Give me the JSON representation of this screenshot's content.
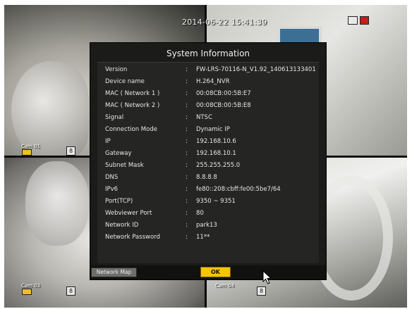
{
  "overlay": {
    "timestamp": "2014-06-22 15:41:39",
    "cameras": [
      {
        "label": "Cam 01",
        "channel": "8"
      },
      {
        "label": "Cam 03",
        "channel": "8"
      },
      {
        "label": "Cam 04",
        "channel": "8"
      }
    ]
  },
  "dialog": {
    "title": "System Information",
    "rows": [
      {
        "key": "Version",
        "value": "FW-LRS-70116-N_V1.92_140613133401"
      },
      {
        "key": "Device name",
        "value": "H.264_NVR"
      },
      {
        "key": "MAC ( Network 1 )",
        "value": "00:08CB:00:5B:E7"
      },
      {
        "key": "MAC ( Network 2 )",
        "value": "00:08CB:00:5B:E8"
      },
      {
        "key": "Signal",
        "value": "NTSC"
      },
      {
        "key": "Connection Mode",
        "value": "Dynamic IP"
      },
      {
        "key": "IP",
        "value": "192.168.10.6"
      },
      {
        "key": "Gateway",
        "value": "192.168.10.1"
      },
      {
        "key": "Subnet Mask",
        "value": "255.255.255.0"
      },
      {
        "key": "DNS",
        "value": "8.8.8.8"
      },
      {
        "key": "IPv6",
        "value": "fe80::208:cbff:fe00:5be7/64"
      },
      {
        "key": "Port(TCP)",
        "value": "9350 ~ 9351"
      },
      {
        "key": "Webviewer Port",
        "value": "80"
      },
      {
        "key": "Network ID",
        "value": "park13"
      },
      {
        "key": "Network Password",
        "value": "11**"
      }
    ],
    "separator": ":",
    "network_map_label": "Network Map",
    "ok_label": "OK"
  },
  "colors": {
    "ok_button": "#f5c500",
    "dialog_bg": "#1b1b19",
    "record_badge": "#f0c020"
  },
  "icons": [
    "hdd-icon",
    "record-icon",
    "mouse-cursor-icon"
  ]
}
